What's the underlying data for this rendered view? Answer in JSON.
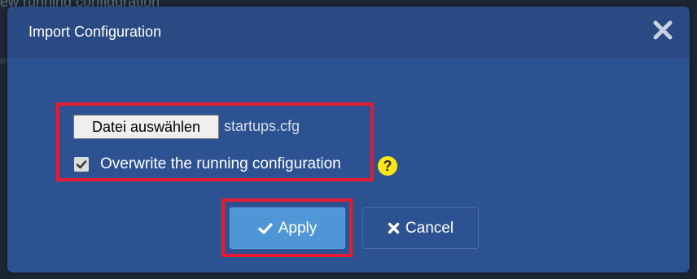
{
  "background": {
    "partial_text": "ew running configuration",
    "partial_text_2": "es"
  },
  "dialog": {
    "title": "Import Configuration",
    "close_icon": "close-icon",
    "file_picker": {
      "button_label": "Datei auswählen",
      "selected_file": "startups.cfg"
    },
    "overwrite": {
      "checked": true,
      "label": "Overwrite the running configuration",
      "help_glyph": "?"
    },
    "buttons": {
      "apply_label": "Apply",
      "apply_icon": "check-icon",
      "cancel_label": "Cancel",
      "cancel_icon": "x-icon"
    }
  },
  "colors": {
    "modal_bg": "#2d5292",
    "header_bg": "#294a82",
    "highlight": "#e41c33",
    "apply_button": "#4e96d6",
    "help_icon": "#ffe716"
  }
}
